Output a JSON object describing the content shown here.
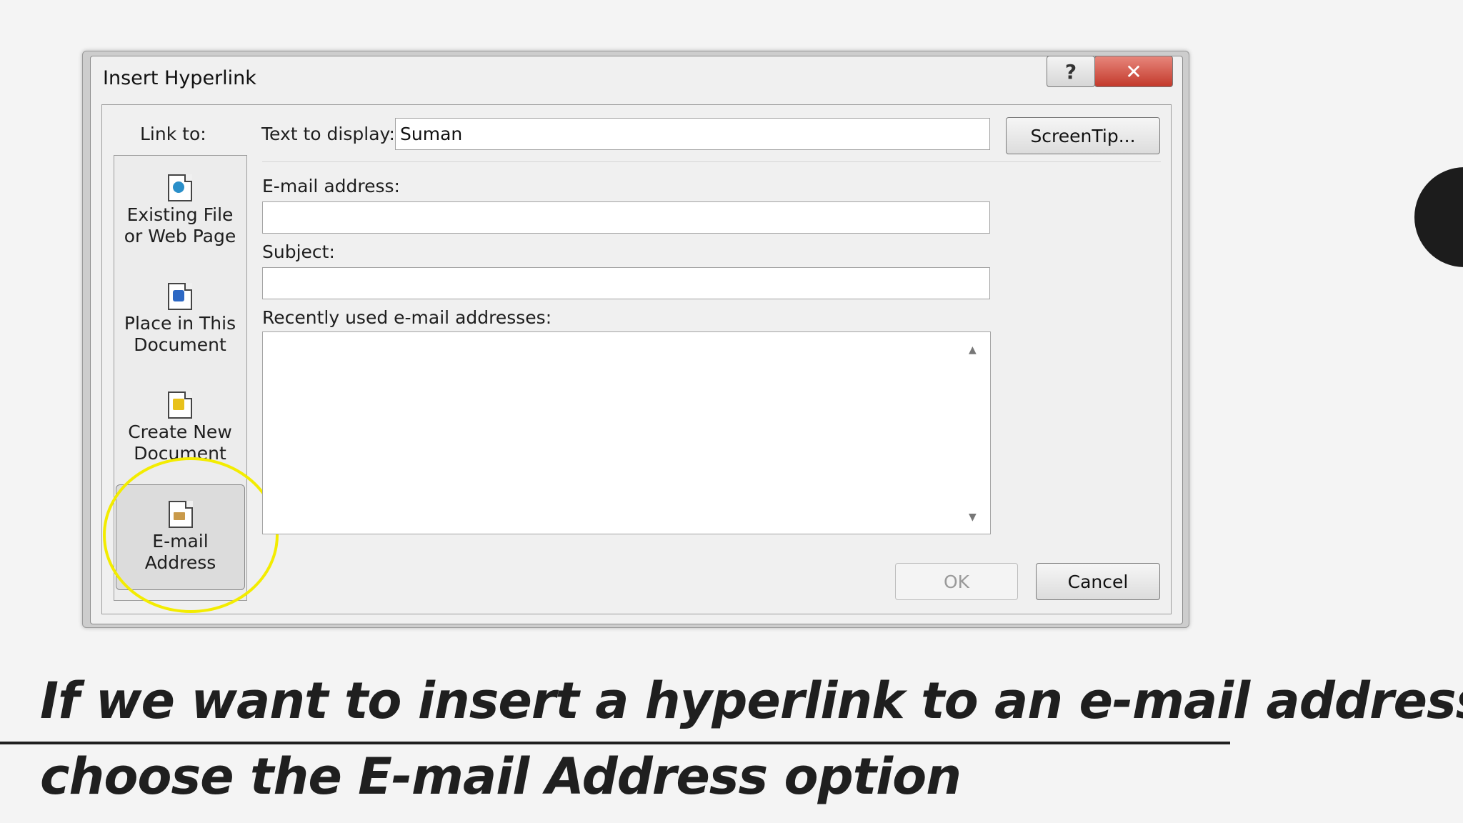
{
  "dialog": {
    "title": "Insert Hyperlink",
    "help_icon": "question-mark-icon",
    "close_icon": "close-x-icon",
    "link_to_label": "Link to:",
    "text_to_display_label": "Text to display:",
    "text_to_display_value": "Suman",
    "screentip_label": "ScreenTip...",
    "link_items": [
      {
        "line1": "Existing File",
        "line2": "or Web Page",
        "icon": "file-globe-icon"
      },
      {
        "line1": "Place in This",
        "line2": "Document",
        "icon": "document-bookmark-icon"
      },
      {
        "line1": "Create New",
        "line2": "Document",
        "icon": "new-document-icon"
      },
      {
        "line1": "E-mail",
        "line2": "Address",
        "icon": "email-envelope-icon"
      }
    ],
    "selected_link": "E-mail Address",
    "email_label": "E-mail address:",
    "email_value": "",
    "subject_label": "Subject:",
    "subject_value": "",
    "recent_label": "Recently used e-mail addresses:",
    "ok_label": "OK",
    "cancel_label": "Cancel"
  },
  "caption": {
    "line1": "If we want to insert a hyperlink to an e-mail address,",
    "line2": "choose the E-mail Address option"
  },
  "colors": {
    "highlight": "#f3ec00",
    "close_button": "#c33a2c"
  }
}
